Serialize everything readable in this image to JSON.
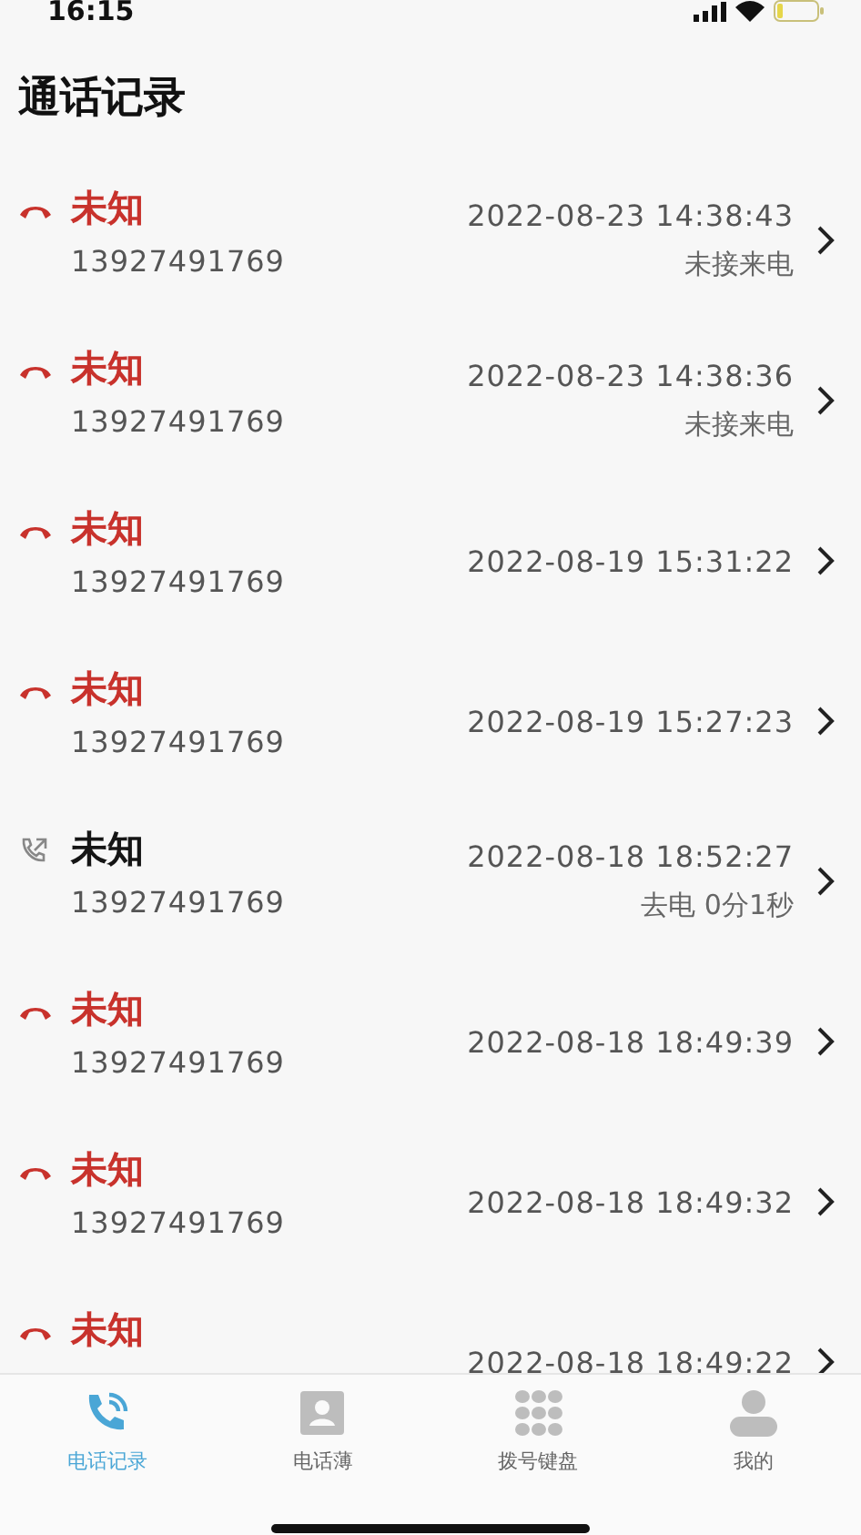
{
  "status_bar": {
    "time": "16:15"
  },
  "title": "通话记录",
  "calls": [
    {
      "kind": "missed",
      "name": "未知",
      "number": "13927491769",
      "datetime": "2022-08-23 14:38:43",
      "detail": "未接来电"
    },
    {
      "kind": "missed",
      "name": "未知",
      "number": "13927491769",
      "datetime": "2022-08-23 14:38:36",
      "detail": "未接来电"
    },
    {
      "kind": "missed",
      "name": "未知",
      "number": "13927491769",
      "datetime": "2022-08-19 15:31:22"
    },
    {
      "kind": "missed",
      "name": "未知",
      "number": "13927491769",
      "datetime": "2022-08-19 15:27:23"
    },
    {
      "kind": "outgoing",
      "name": "未知",
      "number": "13927491769",
      "datetime": "2022-08-18 18:52:27",
      "detail": "去电 0分1秒"
    },
    {
      "kind": "missed",
      "name": "未知",
      "number": "13927491769",
      "datetime": "2022-08-18 18:49:39"
    },
    {
      "kind": "missed",
      "name": "未知",
      "number": "13927491769",
      "datetime": "2022-08-18 18:49:32"
    },
    {
      "kind": "missed",
      "name": "未知",
      "datetime": "2022-08-18 18:49:22"
    }
  ],
  "tabs": [
    {
      "kind": "calls",
      "label": "电话记录",
      "selected": true
    },
    {
      "kind": "contacts",
      "label": "电话薄",
      "selected": false
    },
    {
      "kind": "dialpad",
      "label": "拨号键盘",
      "selected": false
    },
    {
      "kind": "me",
      "label": "我的",
      "selected": false
    }
  ]
}
